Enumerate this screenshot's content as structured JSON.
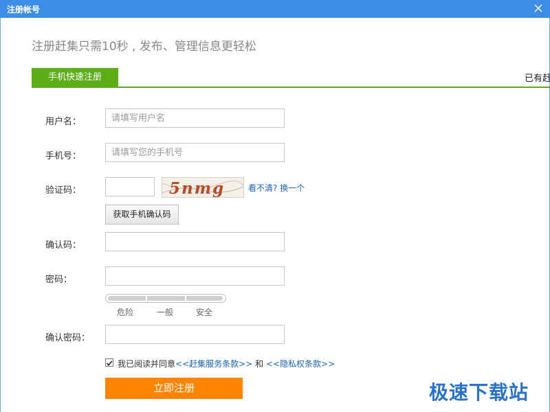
{
  "window": {
    "title": "注册帐号"
  },
  "header": {
    "slogan": "注册赶集只需10秒 , 发布、管理信息更轻松"
  },
  "tabs": [
    {
      "label": "手机快速注册"
    }
  ],
  "login_hint": "已有赶",
  "form": {
    "username": {
      "label": "用户名：",
      "placeholder": "请填写用户名"
    },
    "phone": {
      "label": "手机号：",
      "placeholder": "请填写您的手机号"
    },
    "captcha": {
      "label": "验证码：",
      "image_text": "5nmg",
      "refresh_link": "看不清? 换一个"
    },
    "sms_button": "获取手机确认码",
    "confirm_code": {
      "label": "确认码："
    },
    "password": {
      "label": "密码："
    },
    "strength": [
      "危险",
      "一般",
      "安全"
    ],
    "confirm_password": {
      "label": "确认密码："
    },
    "agreement": {
      "checked": true,
      "prefix": "我已阅读并同意",
      "service_link": "<<赶集服务条款>>",
      "and": "和",
      "privacy_link": "<<隐私权条款>>"
    },
    "submit": "立即注册"
  },
  "watermark": "极速下载站",
  "colors": {
    "titlebar": "#3c8ee6",
    "tab_green": "#5cad18",
    "submit_orange": "#ff8500",
    "link_blue": "#1a63b8"
  }
}
